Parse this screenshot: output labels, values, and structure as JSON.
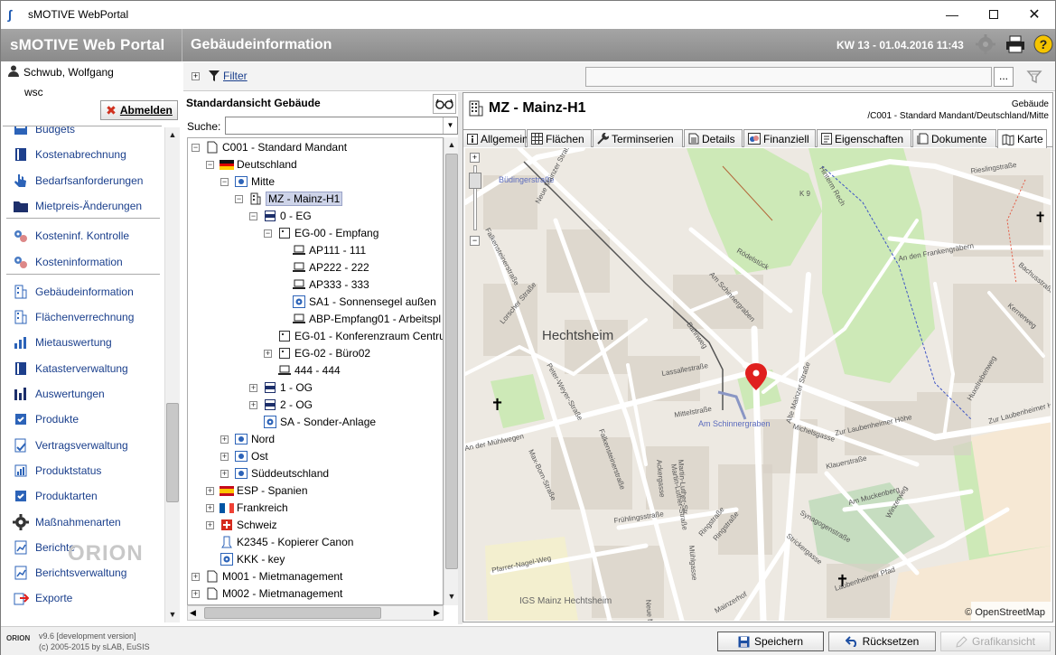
{
  "window": {
    "title": "sMOTIVE WebPortal",
    "controls": [
      "minimize",
      "maximize",
      "close"
    ]
  },
  "header": {
    "brand": "sMOTIVE Web Portal",
    "page_title": "Gebäudeinformation",
    "week_date": "KW 13 - 01.04.2016 11:43"
  },
  "user": {
    "name": "Schwub, Wolfgang",
    "id": "wsc",
    "logout_label": "Abmelden"
  },
  "nav": {
    "groups": [
      [
        {
          "label": "Budgets",
          "icon": "budget-icon"
        },
        {
          "label": "Kostenabrechnung",
          "icon": "book-icon"
        },
        {
          "label": "Bedarfsanforderungen",
          "icon": "hand-icon"
        },
        {
          "label": "Mietpreis-Änderungen",
          "icon": "folder-icon"
        }
      ],
      [
        {
          "label": "Kosteninf. Kontrolle",
          "icon": "gears-icon"
        },
        {
          "label": "Kosteninformation",
          "icon": "gears-icon"
        }
      ],
      [
        {
          "label": "Gebäudeinformation",
          "icon": "building-icon"
        },
        {
          "label": "Flächenverrechnung",
          "icon": "building-icon"
        },
        {
          "label": "Mietauswertung",
          "icon": "chart-icon"
        },
        {
          "label": "Katasterverwaltung",
          "icon": "book-icon"
        },
        {
          "label": "Auswertungen",
          "icon": "barchart-icon"
        },
        {
          "label": "Produkte",
          "icon": "product-icon"
        },
        {
          "label": "Vertragsverwaltung",
          "icon": "contract-icon"
        },
        {
          "label": "Produktstatus",
          "icon": "status-icon"
        },
        {
          "label": "Produktarten",
          "icon": "product-icon"
        },
        {
          "label": "Maßnahmenarten",
          "icon": "gear-icon"
        },
        {
          "label": "Berichte",
          "icon": "report-icon"
        },
        {
          "label": "Berichtsverwaltung",
          "icon": "report-icon"
        },
        {
          "label": "Exporte",
          "icon": "export-icon"
        }
      ]
    ]
  },
  "filter": {
    "label": "Filter",
    "input_value": "",
    "more_label": "..."
  },
  "tree": {
    "panel_title": "Standardansicht Gebäude",
    "search_label": "Suche:",
    "search_value": "",
    "nodes": [
      {
        "label": "C001 - Standard Mandant",
        "level": 0,
        "toggle": "−",
        "icon": "doc"
      },
      {
        "label": "Deutschland",
        "level": 1,
        "toggle": "−",
        "icon": "flag-de"
      },
      {
        "label": "Mitte",
        "level": 2,
        "toggle": "−",
        "icon": "site"
      },
      {
        "label": "MZ - Mainz-H1",
        "level": 3,
        "toggle": "−",
        "icon": "building",
        "selected": true
      },
      {
        "label": "0 - EG",
        "level": 4,
        "toggle": "−",
        "icon": "floor"
      },
      {
        "label": "EG-00 - Empfang",
        "level": 5,
        "toggle": "−",
        "icon": "room"
      },
      {
        "label": "AP111 - 111",
        "level": 6,
        "toggle": "",
        "icon": "pc"
      },
      {
        "label": "AP222 - 222",
        "level": 6,
        "toggle": "",
        "icon": "pc"
      },
      {
        "label": "AP333 - 333",
        "level": 6,
        "toggle": "",
        "icon": "pc"
      },
      {
        "label": "SA1 - Sonnensegel außen",
        "level": 6,
        "toggle": "",
        "icon": "gear"
      },
      {
        "label": "ABP-Empfang01 - Arbeitspl",
        "level": 6,
        "toggle": "",
        "icon": "pc"
      },
      {
        "label": "EG-01 - Konferenzraum Centru",
        "level": 5,
        "toggle": "",
        "icon": "room"
      },
      {
        "label": "EG-02 - Büro02",
        "level": 5,
        "toggle": "+",
        "icon": "room"
      },
      {
        "label": "444 - 444",
        "level": 5,
        "toggle": "",
        "icon": "pc"
      },
      {
        "label": "1 - OG",
        "level": 4,
        "toggle": "+",
        "icon": "floor"
      },
      {
        "label": "2 - OG",
        "level": 4,
        "toggle": "+",
        "icon": "floor"
      },
      {
        "label": "SA - Sonder-Anlage",
        "level": 4,
        "toggle": "",
        "icon": "gear"
      },
      {
        "label": "Nord",
        "level": 2,
        "toggle": "+",
        "icon": "site"
      },
      {
        "label": "Ost",
        "level": 2,
        "toggle": "+",
        "icon": "site"
      },
      {
        "label": "Süddeutschland",
        "level": 2,
        "toggle": "+",
        "icon": "site"
      },
      {
        "label": "ESP - Spanien",
        "level": 1,
        "toggle": "+",
        "icon": "flag-es"
      },
      {
        "label": "Frankreich",
        "level": 1,
        "toggle": "+",
        "icon": "flag-fr"
      },
      {
        "label": "Schweiz",
        "level": 1,
        "toggle": "+",
        "icon": "flag-ch"
      },
      {
        "label": "K2345 - Kopierer Canon",
        "level": 1,
        "toggle": "",
        "icon": "tool"
      },
      {
        "label": "KKK - key",
        "level": 1,
        "toggle": "",
        "icon": "gear"
      },
      {
        "label": "M001 - Mietmanagement",
        "level": 0,
        "toggle": "+",
        "icon": "doc"
      },
      {
        "label": "M002 - Mietmanagement",
        "level": 0,
        "toggle": "+",
        "icon": "doc"
      }
    ]
  },
  "detail": {
    "title": "MZ - Mainz-H1",
    "type_label": "Gebäude",
    "path": "/C001 - Standard Mandant/Deutschland/Mitte",
    "tabs": [
      {
        "label": "Allgemein",
        "icon": "info-icon"
      },
      {
        "label": "Flächen",
        "icon": "grid-icon"
      },
      {
        "label": "Terminserien",
        "icon": "wrench-icon"
      },
      {
        "label": "Details",
        "icon": "doc-icon"
      },
      {
        "label": "Finanziell",
        "icon": "coins-icon"
      },
      {
        "label": "Eigenschaften",
        "icon": "props-icon"
      },
      {
        "label": "Dokumente",
        "icon": "docs-icon"
      },
      {
        "label": "Karte",
        "icon": "map-icon",
        "active": true
      }
    ]
  },
  "map": {
    "attribution": "© OpenStreetMap",
    "district": "Hechtsheim",
    "streets": [
      "Büdingerstraße",
      "Neue Mainzer Straße",
      "Falkensteinerstraße",
      "Lorscher Straße",
      "Peter-Weyer-Straße",
      "Am Schinnergraben",
      "Rödelstück",
      "Bahnweg",
      "Lassallestraße",
      "Mittelstraße",
      "Am Schinnergraben",
      "Alte Mainzer Straße",
      "Michelsgasse",
      "Zur Laubenheimer Höhe",
      "Klauerstraße",
      "Max-Born-Straße",
      "Falkensteinerstraße",
      "Martin-Luther-Straße",
      "Frühlingsstraße",
      "Ringstraße",
      "Am Muckenberg",
      "Synagogenstraße",
      "Strickergasse",
      "Laubenheimer Pfad",
      "Pfarrer-Nagel-Weg",
      "IGS Mainz Hechtsheim",
      "Rieslingstraße",
      "Bachusstraße",
      "An den Frankengräbern",
      "Hinterm Rech",
      "Kernerweg",
      "Huxelrebenweg",
      "Zur Laubenheimer Höhe",
      "Ringstraße",
      "Mainzerhof",
      "Winzerweg",
      "An der Mühlwegen",
      "K 9",
      "Neue Mainzer Straße",
      "Mühlgasse",
      "Ackergasse",
      "Martin-Luther-Str"
    ]
  },
  "footer": {
    "logo": "ORION",
    "version": "v9.6 [development version]",
    "copyright": "(c) 2005-2015 by sLAB, EuSIS",
    "buttons": {
      "save": "Speichern",
      "reset": "Rücksetzen",
      "graphic": "Grafikansicht"
    }
  },
  "watermark": "ORION"
}
